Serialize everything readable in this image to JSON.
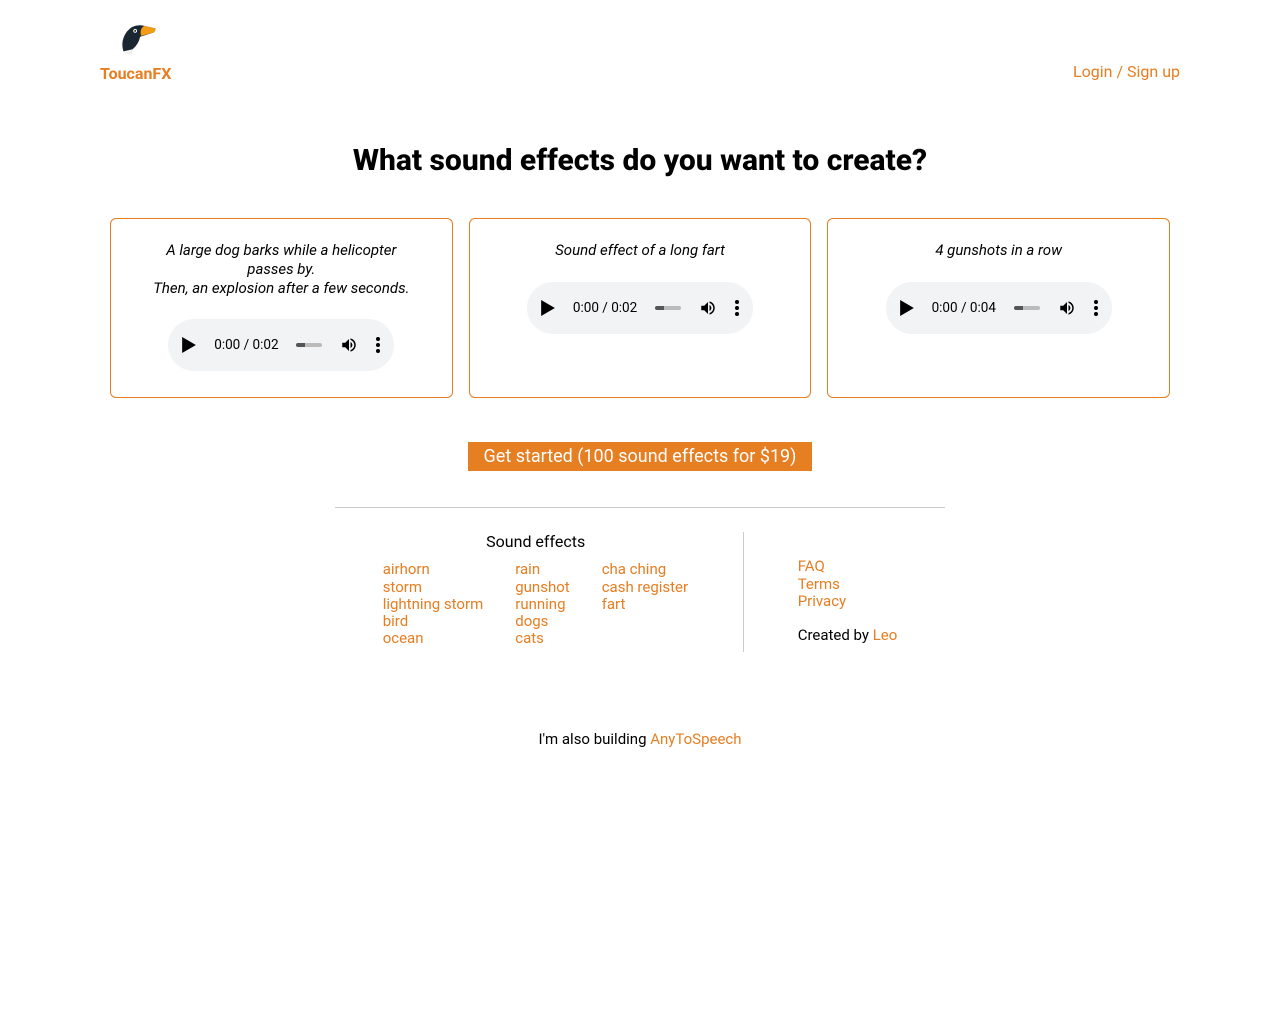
{
  "header": {
    "brand": "ToucanFX",
    "login": "Login / Sign up"
  },
  "title": "What sound effects do you want to create?",
  "cards": [
    {
      "desc_line1": "A large dog barks while a helicopter passes by.",
      "desc_line2": "Then, an explosion after a few seconds.",
      "time": "0:00 / 0:02"
    },
    {
      "desc_line1": "Sound effect of a long fart",
      "desc_line2": "",
      "time": "0:00 / 0:02"
    },
    {
      "desc_line1": "4 gunshots in a row",
      "desc_line2": "",
      "time": "0:00 / 0:04"
    }
  ],
  "cta": "Get started (100 sound effects for $19)",
  "footer": {
    "sound_effects_heading": "Sound effects",
    "columns": [
      [
        "airhorn",
        "storm",
        "lightning storm",
        "bird",
        "ocean"
      ],
      [
        "rain",
        "gunshot",
        "running",
        "dogs",
        "cats"
      ],
      [
        "cha ching",
        "cash register",
        "fart"
      ]
    ],
    "meta_links": [
      "FAQ",
      "Terms",
      "Privacy"
    ],
    "created_by_prefix": "Created by ",
    "created_by_link": "Leo",
    "also_prefix": "I'm also building ",
    "also_link": "AnyToSpeech"
  }
}
